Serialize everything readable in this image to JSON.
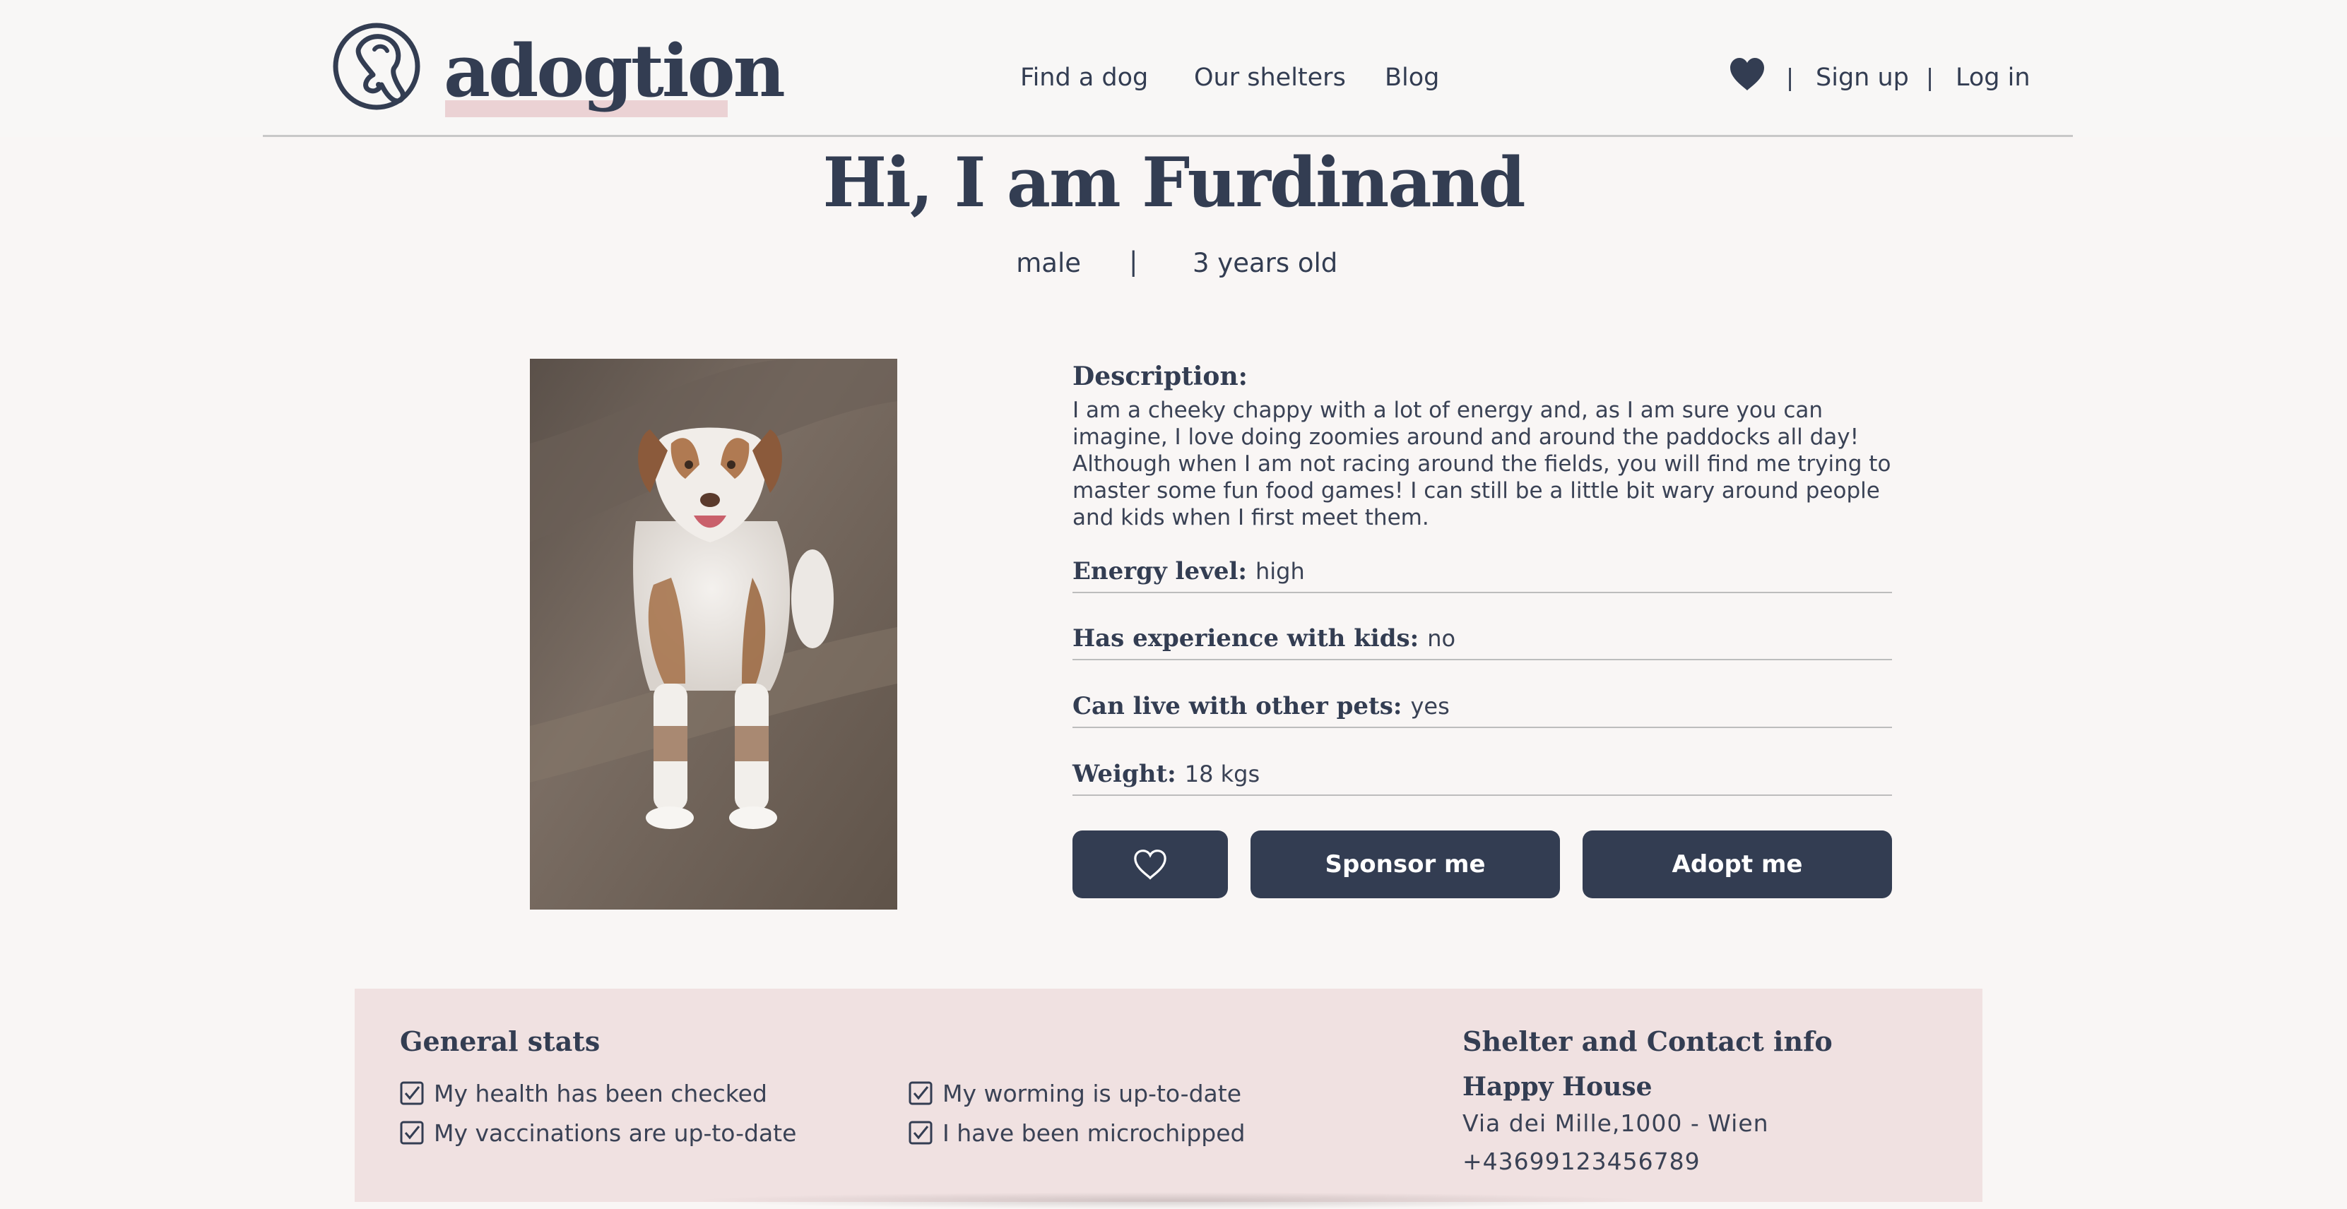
{
  "header": {
    "brand": "adogtion",
    "nav": {
      "find": "Find a dog",
      "shelters": "Our shelters",
      "blog": "Blog",
      "separator": "|",
      "signup": "Sign up",
      "login": "Log in"
    }
  },
  "dog": {
    "title": "Hi, I am Furdinand",
    "gender": "male",
    "separator": "|",
    "age": "3 years old",
    "description_label": "Description:",
    "description": "I am a cheeky chappy with a lot of energy and, as I am sure you can imagine, I love doing zoomies around and around the paddocks all day! Although when I am not racing around the fields, you will find me trying to master some fun food games! I can still be a little bit wary around people and kids when I first meet them.",
    "attributes": [
      {
        "label": "Energy level:",
        "value": "high"
      },
      {
        "label": "Has experience with kids:",
        "value": "no"
      },
      {
        "label": "Can live with other pets:",
        "value": "yes"
      },
      {
        "label": "Weight:",
        "value": "18 kgs"
      }
    ],
    "buttons": {
      "sponsor": "Sponsor me",
      "adopt": "Adopt me"
    }
  },
  "stats": {
    "title": "General stats",
    "items": [
      {
        "label": "My health has been checked",
        "checked": true
      },
      {
        "label": "My worming is up-to-date",
        "checked": true
      },
      {
        "label": "My vaccinations are up-to-date",
        "checked": true
      },
      {
        "label": "I have been microchipped",
        "checked": true
      }
    ]
  },
  "contact": {
    "title": "Shelter and Contact info",
    "shelter_name": "Happy House",
    "address": "Via dei Mille,1000 - Wien",
    "phone": "+43699123456789"
  },
  "colors": {
    "primary": "#333d52",
    "accent_pink": "#ebd2d4",
    "panel": "#f0e1e1",
    "background": "#f9f6f5"
  },
  "icons": {
    "logo": "dog-logo-icon",
    "nav_heart": "heart-filled-icon",
    "fav_button": "heart-outline-icon",
    "check": "checkbox-checked-icon"
  }
}
